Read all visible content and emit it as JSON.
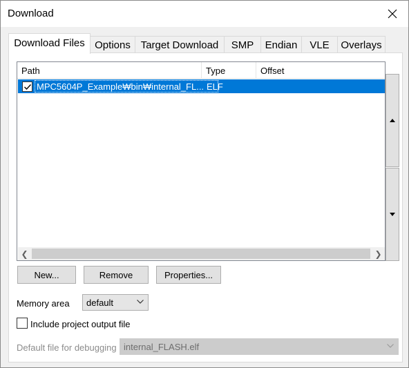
{
  "window": {
    "title": "Download",
    "close_icon": "close-icon"
  },
  "tabs": [
    {
      "label": "Download Files",
      "active": true
    },
    {
      "label": "Options",
      "active": false
    },
    {
      "label": "Target Download",
      "active": false
    },
    {
      "label": "SMP",
      "active": false
    },
    {
      "label": "Endian",
      "active": false
    },
    {
      "label": "VLE",
      "active": false
    },
    {
      "label": "Overlays",
      "active": false
    }
  ],
  "file_list": {
    "columns": [
      "Path",
      "Type",
      "Offset"
    ],
    "rows": [
      {
        "checked": true,
        "path": "MPC5604P_Example₩bin₩internal_FL...",
        "type": "ELF",
        "offset": ""
      }
    ]
  },
  "buttons": {
    "new_label": "New...",
    "remove_label": "Remove",
    "properties_label": "Properties..."
  },
  "memory_area": {
    "label": "Memory area",
    "value": "default"
  },
  "include_output": {
    "label": "Include project output file",
    "checked": false
  },
  "default_debug_file": {
    "label": "Default file for debugging",
    "value": "internal_FLASH.elf"
  },
  "colors": {
    "selection": "#0078d7",
    "dialog_bg": "#f0f0f0"
  }
}
